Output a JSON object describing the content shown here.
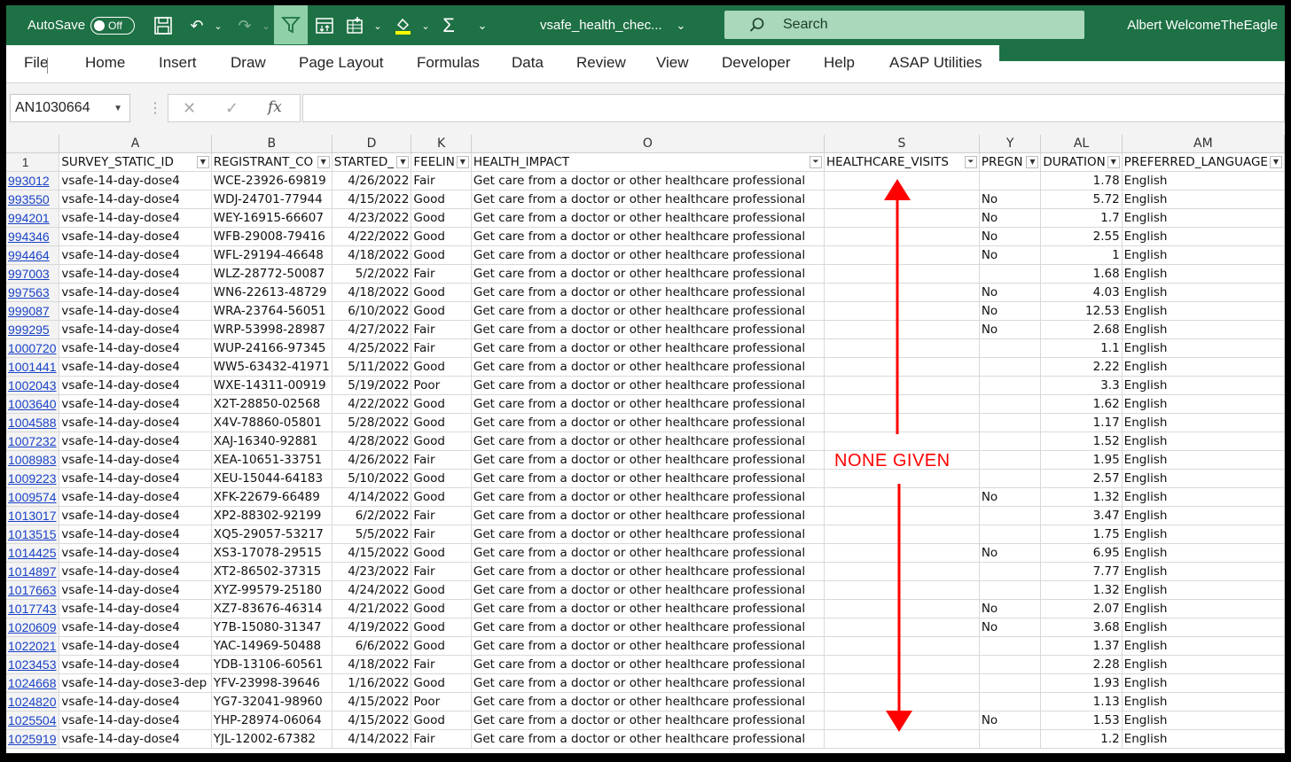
{
  "titlebar": {
    "autosave_label": "AutoSave",
    "autosave_state": "Off",
    "filename": "vsafe_health_chec...",
    "search_placeholder": "Search",
    "user_name": "Albert WelcomeTheEagle"
  },
  "ribbon": {
    "tabs": [
      "File",
      "Home",
      "Insert",
      "Draw",
      "Page Layout",
      "Formulas",
      "Data",
      "Review",
      "View",
      "Developer",
      "Help",
      "ASAP Utilities"
    ]
  },
  "formula_bar": {
    "name_box": "AN1030664",
    "formula": ""
  },
  "columns": [
    "A",
    "B",
    "D",
    "K",
    "O",
    "S",
    "Y",
    "AL",
    "AM"
  ],
  "header_row_num": "1",
  "headers": [
    "SURVEY_STATIC_ID",
    "REGISTRANT_CO",
    "STARTED_",
    "FEELIN",
    "HEALTH_IMPACT",
    "HEALTHCARE_VISITS",
    "PREGN",
    "DURATION",
    "PREFERRED_LANGUAGE"
  ],
  "rows": [
    {
      "r": "993012",
      "a": "vsafe-14-day-dose4",
      "b": "WCE-23926-69819",
      "d": "4/26/2022",
      "k": "Fair",
      "o": "Get care from a doctor or other healthcare professional",
      "s": "",
      "y": "",
      "al": "1.78",
      "am": "English"
    },
    {
      "r": "993550",
      "a": "vsafe-14-day-dose4",
      "b": "WDJ-24701-77944",
      "d": "4/15/2022",
      "k": "Good",
      "o": "Get care from a doctor or other healthcare professional",
      "s": "",
      "y": "No",
      "al": "5.72",
      "am": "English"
    },
    {
      "r": "994201",
      "a": "vsafe-14-day-dose4",
      "b": "WEY-16915-66607",
      "d": "4/23/2022",
      "k": "Good",
      "o": "Get care from a doctor or other healthcare professional",
      "s": "",
      "y": "No",
      "al": "1.7",
      "am": "English"
    },
    {
      "r": "994346",
      "a": "vsafe-14-day-dose4",
      "b": "WFB-29008-79416",
      "d": "4/22/2022",
      "k": "Good",
      "o": "Get care from a doctor or other healthcare professional",
      "s": "",
      "y": "No",
      "al": "2.55",
      "am": "English"
    },
    {
      "r": "994464",
      "a": "vsafe-14-day-dose4",
      "b": "WFL-29194-46648",
      "d": "4/18/2022",
      "k": "Good",
      "o": "Get care from a doctor or other healthcare professional",
      "s": "",
      "y": "No",
      "al": "1",
      "am": "English"
    },
    {
      "r": "997003",
      "a": "vsafe-14-day-dose4",
      "b": "WLZ-28772-50087",
      "d": "5/2/2022",
      "k": "Fair",
      "o": "Get care from a doctor or other healthcare professional",
      "s": "",
      "y": "",
      "al": "1.68",
      "am": "English"
    },
    {
      "r": "997563",
      "a": "vsafe-14-day-dose4",
      "b": "WN6-22613-48729",
      "d": "4/18/2022",
      "k": "Good",
      "o": "Get care from a doctor or other healthcare professional",
      "s": "",
      "y": "No",
      "al": "4.03",
      "am": "English"
    },
    {
      "r": "999087",
      "a": "vsafe-14-day-dose4",
      "b": "WRA-23764-56051",
      "d": "6/10/2022",
      "k": "Good",
      "o": "Get care from a doctor or other healthcare professional",
      "s": "",
      "y": "No",
      "al": "12.53",
      "am": "English"
    },
    {
      "r": "999295",
      "a": "vsafe-14-day-dose4",
      "b": "WRP-53998-28987",
      "d": "4/27/2022",
      "k": "Fair",
      "o": "Get care from a doctor or other healthcare professional",
      "s": "",
      "y": "No",
      "al": "2.68",
      "am": "English"
    },
    {
      "r": "1000720",
      "a": "vsafe-14-day-dose4",
      "b": "WUP-24166-97345",
      "d": "4/25/2022",
      "k": "Fair",
      "o": "Get care from a doctor or other healthcare professional",
      "s": "",
      "y": "",
      "al": "1.1",
      "am": "English"
    },
    {
      "r": "1001441",
      "a": "vsafe-14-day-dose4",
      "b": "WW5-63432-41971",
      "d": "5/11/2022",
      "k": "Good",
      "o": "Get care from a doctor or other healthcare professional",
      "s": "",
      "y": "",
      "al": "2.22",
      "am": "English"
    },
    {
      "r": "1002043",
      "a": "vsafe-14-day-dose4",
      "b": "WXE-14311-00919",
      "d": "5/19/2022",
      "k": "Poor",
      "o": "Get care from a doctor or other healthcare professional",
      "s": "",
      "y": "",
      "al": "3.3",
      "am": "English"
    },
    {
      "r": "1003640",
      "a": "vsafe-14-day-dose4",
      "b": "X2T-28850-02568",
      "d": "4/22/2022",
      "k": "Good",
      "o": "Get care from a doctor or other healthcare professional",
      "s": "",
      "y": "",
      "al": "1.62",
      "am": "English"
    },
    {
      "r": "1004588",
      "a": "vsafe-14-day-dose4",
      "b": "X4V-78860-05801",
      "d": "5/28/2022",
      "k": "Good",
      "o": "Get care from a doctor or other healthcare professional",
      "s": "",
      "y": "",
      "al": "1.17",
      "am": "English"
    },
    {
      "r": "1007232",
      "a": "vsafe-14-day-dose4",
      "b": "XAJ-16340-92881",
      "d": "4/28/2022",
      "k": "Good",
      "o": "Get care from a doctor or other healthcare professional",
      "s": "",
      "y": "",
      "al": "1.52",
      "am": "English"
    },
    {
      "r": "1008983",
      "a": "vsafe-14-day-dose4",
      "b": "XEA-10651-33751",
      "d": "4/26/2022",
      "k": "Fair",
      "o": "Get care from a doctor or other healthcare professional",
      "s": "",
      "y": "",
      "al": "1.95",
      "am": "English"
    },
    {
      "r": "1009223",
      "a": "vsafe-14-day-dose4",
      "b": "XEU-15044-64183",
      "d": "5/10/2022",
      "k": "Good",
      "o": "Get care from a doctor or other healthcare professional",
      "s": "",
      "y": "",
      "al": "2.57",
      "am": "English"
    },
    {
      "r": "1009574",
      "a": "vsafe-14-day-dose4",
      "b": "XFK-22679-66489",
      "d": "4/14/2022",
      "k": "Good",
      "o": "Get care from a doctor or other healthcare professional",
      "s": "",
      "y": "No",
      "al": "1.32",
      "am": "English"
    },
    {
      "r": "1013017",
      "a": "vsafe-14-day-dose4",
      "b": "XP2-88302-92199",
      "d": "6/2/2022",
      "k": "Fair",
      "o": "Get care from a doctor or other healthcare professional",
      "s": "",
      "y": "",
      "al": "3.47",
      "am": "English"
    },
    {
      "r": "1013515",
      "a": "vsafe-14-day-dose4",
      "b": "XQ5-29057-53217",
      "d": "5/5/2022",
      "k": "Fair",
      "o": "Get care from a doctor or other healthcare professional",
      "s": "",
      "y": "",
      "al": "1.75",
      "am": "English"
    },
    {
      "r": "1014425",
      "a": "vsafe-14-day-dose4",
      "b": "XS3-17078-29515",
      "d": "4/15/2022",
      "k": "Good",
      "o": "Get care from a doctor or other healthcare professional",
      "s": "",
      "y": "No",
      "al": "6.95",
      "am": "English"
    },
    {
      "r": "1014897",
      "a": "vsafe-14-day-dose4",
      "b": "XT2-86502-37315",
      "d": "4/23/2022",
      "k": "Fair",
      "o": "Get care from a doctor or other healthcare professional",
      "s": "",
      "y": "",
      "al": "7.77",
      "am": "English"
    },
    {
      "r": "1017663",
      "a": "vsafe-14-day-dose4",
      "b": "XYZ-99579-25180",
      "d": "4/24/2022",
      "k": "Good",
      "o": "Get care from a doctor or other healthcare professional",
      "s": "",
      "y": "",
      "al": "1.32",
      "am": "English"
    },
    {
      "r": "1017743",
      "a": "vsafe-14-day-dose4",
      "b": "XZ7-83676-46314",
      "d": "4/21/2022",
      "k": "Good",
      "o": "Get care from a doctor or other healthcare professional",
      "s": "",
      "y": "No",
      "al": "2.07",
      "am": "English"
    },
    {
      "r": "1020609",
      "a": "vsafe-14-day-dose4",
      "b": "Y7B-15080-31347",
      "d": "4/19/2022",
      "k": "Good",
      "o": "Get care from a doctor or other healthcare professional",
      "s": "",
      "y": "No",
      "al": "3.68",
      "am": "English"
    },
    {
      "r": "1022021",
      "a": "vsafe-14-day-dose4",
      "b": "YAC-14969-50488",
      "d": "6/6/2022",
      "k": "Good",
      "o": "Get care from a doctor or other healthcare professional",
      "s": "",
      "y": "",
      "al": "1.37",
      "am": "English"
    },
    {
      "r": "1023453",
      "a": "vsafe-14-day-dose4",
      "b": "YDB-13106-60561",
      "d": "4/18/2022",
      "k": "Fair",
      "o": "Get care from a doctor or other healthcare professional",
      "s": "",
      "y": "",
      "al": "2.28",
      "am": "English"
    },
    {
      "r": "1024668",
      "a": "vsafe-14-day-dose3-dep",
      "b": "YFV-23998-39646",
      "d": "1/16/2022",
      "k": "Good",
      "o": "Get care from a doctor or other healthcare professional",
      "s": "",
      "y": "",
      "al": "1.93",
      "am": "English"
    },
    {
      "r": "1024820",
      "a": "vsafe-14-day-dose4",
      "b": "YG7-32041-98960",
      "d": "4/15/2022",
      "k": "Poor",
      "o": "Get care from a doctor or other healthcare professional",
      "s": "",
      "y": "",
      "al": "1.13",
      "am": "English"
    },
    {
      "r": "1025504",
      "a": "vsafe-14-day-dose4",
      "b": "YHP-28974-06064",
      "d": "4/15/2022",
      "k": "Good",
      "o": "Get care from a doctor or other healthcare professional",
      "s": "",
      "y": "No",
      "al": "1.53",
      "am": "English"
    },
    {
      "r": "1025919",
      "a": "vsafe-14-day-dose4",
      "b": "YJL-12002-67382",
      "d": "4/14/2022",
      "k": "Fair",
      "o": "Get care from a doctor or other healthcare professional",
      "s": "",
      "y": "",
      "al": "1.2",
      "am": "English"
    }
  ],
  "annotation": {
    "text": "NONE GIVEN",
    "color": "#ff0000"
  },
  "colors": {
    "excel_green": "#1e7145",
    "search_bg": "#a9d8ba",
    "link_blue": "#1a43c8"
  }
}
